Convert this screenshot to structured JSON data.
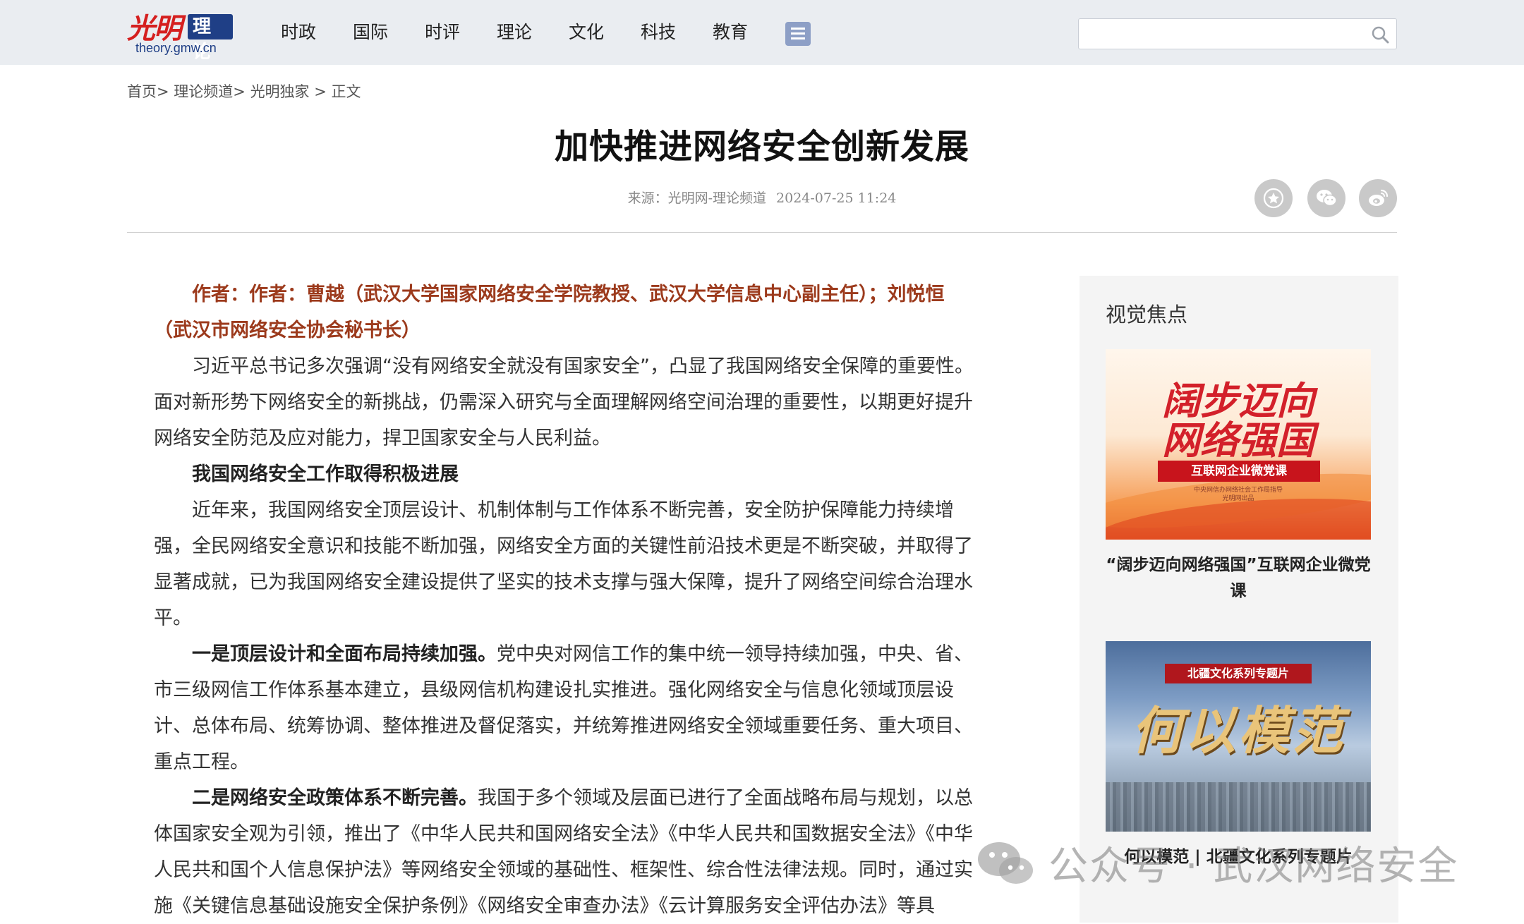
{
  "header": {
    "logo": {
      "mark": "光明",
      "badge": "理论",
      "url": "theory.gmw.cn"
    },
    "nav": [
      "时政",
      "国际",
      "时评",
      "理论",
      "文化",
      "科技",
      "教育"
    ],
    "search": {
      "value": "",
      "placeholder": ""
    }
  },
  "breadcrumb": [
    "首页",
    "理论频道",
    "光明独家",
    "正文"
  ],
  "article": {
    "title": "加快推进网络安全创新发展",
    "source": "来源：光明网-理论频道",
    "date": "2024-07-25 11:24",
    "author": "作者：作者：曹越（武汉大学国家网络安全学院教授、武汉大学信息中心副主任）；刘悦恒（武汉市网络安全协会秘书长）",
    "p1": "习近平总书记多次强调“没有网络安全就没有国家安全”，凸显了我国网络安全保障的重要性。面对新形势下网络安全的新挑战，仍需深入研究与全面理解网络空间治理的重要性，以期更好提升网络安全防范及应对能力，捍卫国家安全与人民利益。",
    "subhead": "我国网络安全工作取得积极进展",
    "p2": "近年来，我国网络安全顶层设计、机制体制与工作体系不断完善，安全防护保障能力持续增强，全民网络安全意识和技能不断加强，网络安全方面的关键性前沿技术更是不断突破，并取得了显著成就，已为我国网络安全建设提供了坚实的技术支撑与强大保障，提升了网络空间综合治理水平。",
    "p3_lead": "一是顶层设计和全面布局持续加强。",
    "p3": "党中央对网信工作的集中统一领导持续加强，中央、省、市三级网信工作体系基本建立，县级网信机构建设扎实推进。强化网络安全与信息化领域顶层设计、总体布局、统筹协调、整体推进及督促落实，并统筹推进网络安全领域重要任务、重大项目、重点工程。",
    "p4_lead": "二是网络安全政策体系不断完善。",
    "p4": "我国于多个领域及层面已进行了全面战略布局与规划，以总体国家安全观为引领，推出了《中华人民共和国网络安全法》《中华人民共和国数据安全法》《中华人民共和国个人信息保护法》等网络安全领域的基础性、框架性、综合性法律法规。同时，通过实施《关键信息基础设施安全保护条例》《网络安全审查办法》《云计算服务安全评估办法》等具"
  },
  "sidebar": {
    "title": "视觉焦点",
    "cards": [
      {
        "image_text": "阔步迈向网络强国",
        "image_line1": "阔步迈向",
        "image_line2": "网络强国",
        "image_band": "互联网企业微党课",
        "image_small1": "中央网信办网络社会工作局指导",
        "image_small2": "光明网出品",
        "caption": "“阔步迈向网络强国”互联网企业微党课"
      },
      {
        "image_tag": "北疆文化系列专题片",
        "image_big": "何以模范",
        "caption": "何以模范 | 北疆文化系列专题片"
      }
    ]
  },
  "watermark": "公众号 · 武汉网络安全",
  "colors": {
    "accent_blue": "#1f3f86",
    "logo_red": "#d51f1f",
    "author_brown": "#9c3a1c",
    "topbar_bg": "#eaedf1"
  }
}
